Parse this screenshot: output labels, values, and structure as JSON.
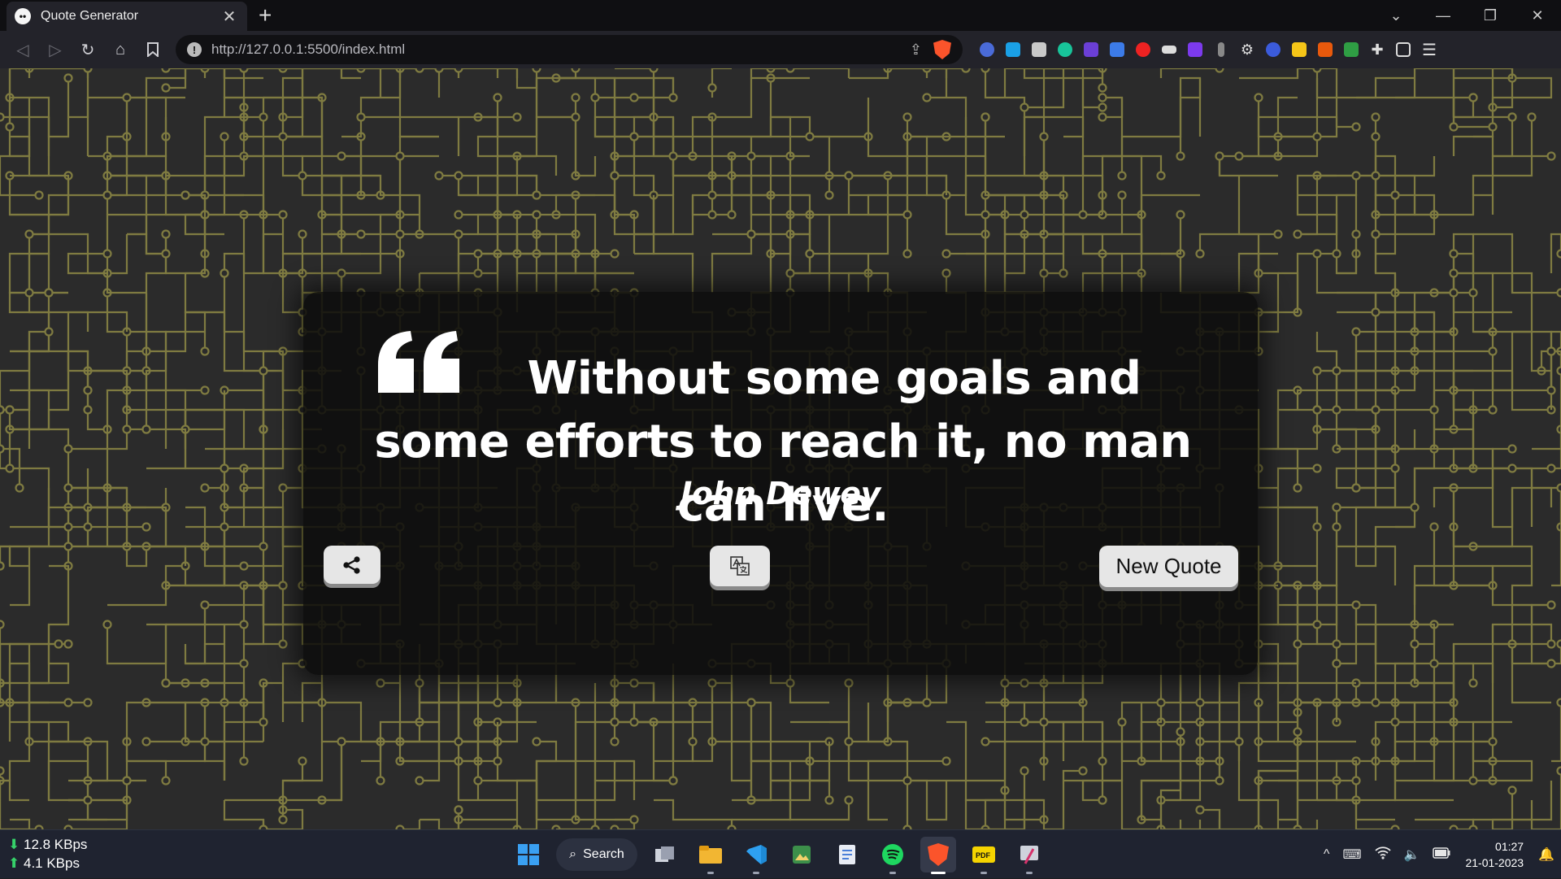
{
  "browser": {
    "tab": {
      "title": "Quote Generator"
    },
    "address": {
      "url": "http://127.0.0.1:5500/index.html"
    }
  },
  "quote": {
    "text": "Without some goals and some efforts to reach it, no man can live.",
    "author": "John Dewey"
  },
  "buttons": {
    "share_icon": "share-icon",
    "translate_icon": "translate-icon",
    "new_quote": "New Quote"
  },
  "taskbar": {
    "download_speed": "12.8 KBps",
    "upload_speed": "4.1 KBps",
    "search_label": "Search",
    "time": "01:27",
    "date": "21-01-2023"
  },
  "colors": {
    "card_bg": "#0c0c0c",
    "circuit_line": "#8e8a45",
    "button_bg": "#e6e6e6",
    "brave_orange": "#fb542b"
  }
}
